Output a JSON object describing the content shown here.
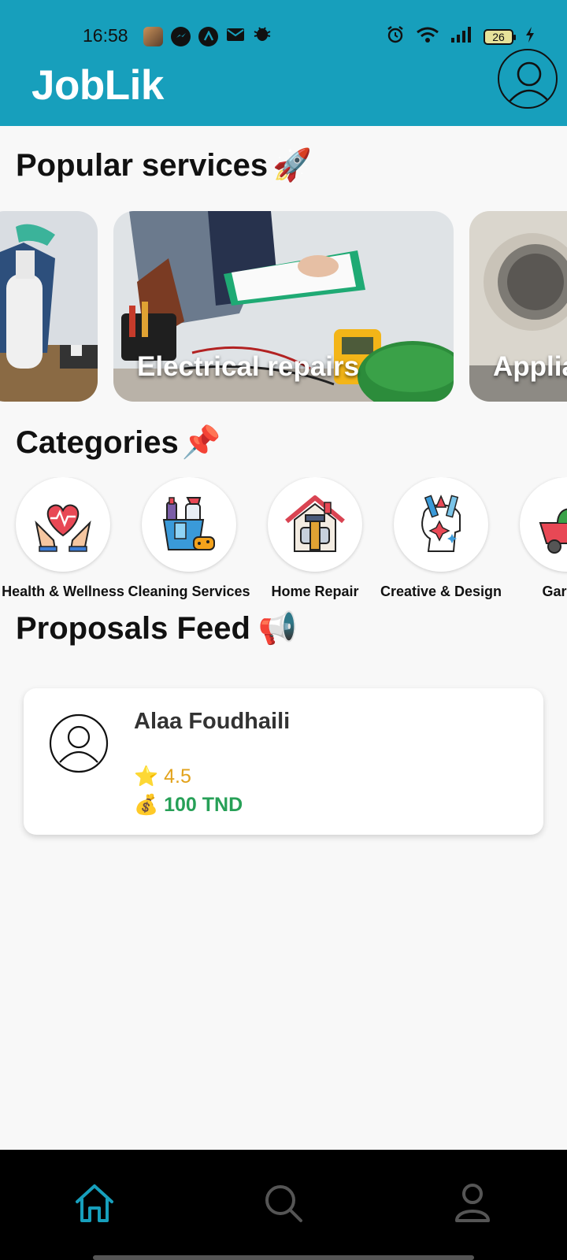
{
  "status_bar": {
    "time": "16:58",
    "battery_level": "26",
    "notification_icons": [
      "photo-icon",
      "messenger-icon",
      "app-icon",
      "mail-icon",
      "bug-icon"
    ],
    "right_icons": [
      "alarm-icon",
      "wifi-icon",
      "signal-icon",
      "battery-icon",
      "charging-icon"
    ]
  },
  "header": {
    "title": "JobLik",
    "background_color": "#179fbc"
  },
  "popular_services": {
    "title": "Popular services",
    "emoji": "🚀",
    "items": [
      {
        "label": ""
      },
      {
        "label": "Electrical repairs"
      },
      {
        "label": "Applia"
      }
    ]
  },
  "categories": {
    "title": "Categories",
    "emoji": "📌",
    "items": [
      {
        "label": "Health & Wellness",
        "icon": "hands-heart-icon"
      },
      {
        "label": "Cleaning Services",
        "icon": "cleaning-bucket-icon"
      },
      {
        "label": "Home Repair",
        "icon": "house-tools-icon"
      },
      {
        "label": "Creative & Design",
        "icon": "creative-head-icon"
      },
      {
        "label": "Garden",
        "icon": "garden-cart-icon"
      }
    ]
  },
  "proposals": {
    "title": "Proposals Feed",
    "emoji": "📢",
    "items": [
      {
        "name": "Alaa Foudhaili",
        "rating_icon": "⭐",
        "rating": "4.5",
        "price_icon": "💰",
        "price": "100 TND"
      }
    ]
  },
  "bottom_nav": {
    "items": [
      "home-icon",
      "search-icon",
      "profile-icon"
    ],
    "active_color": "#179fbc"
  }
}
